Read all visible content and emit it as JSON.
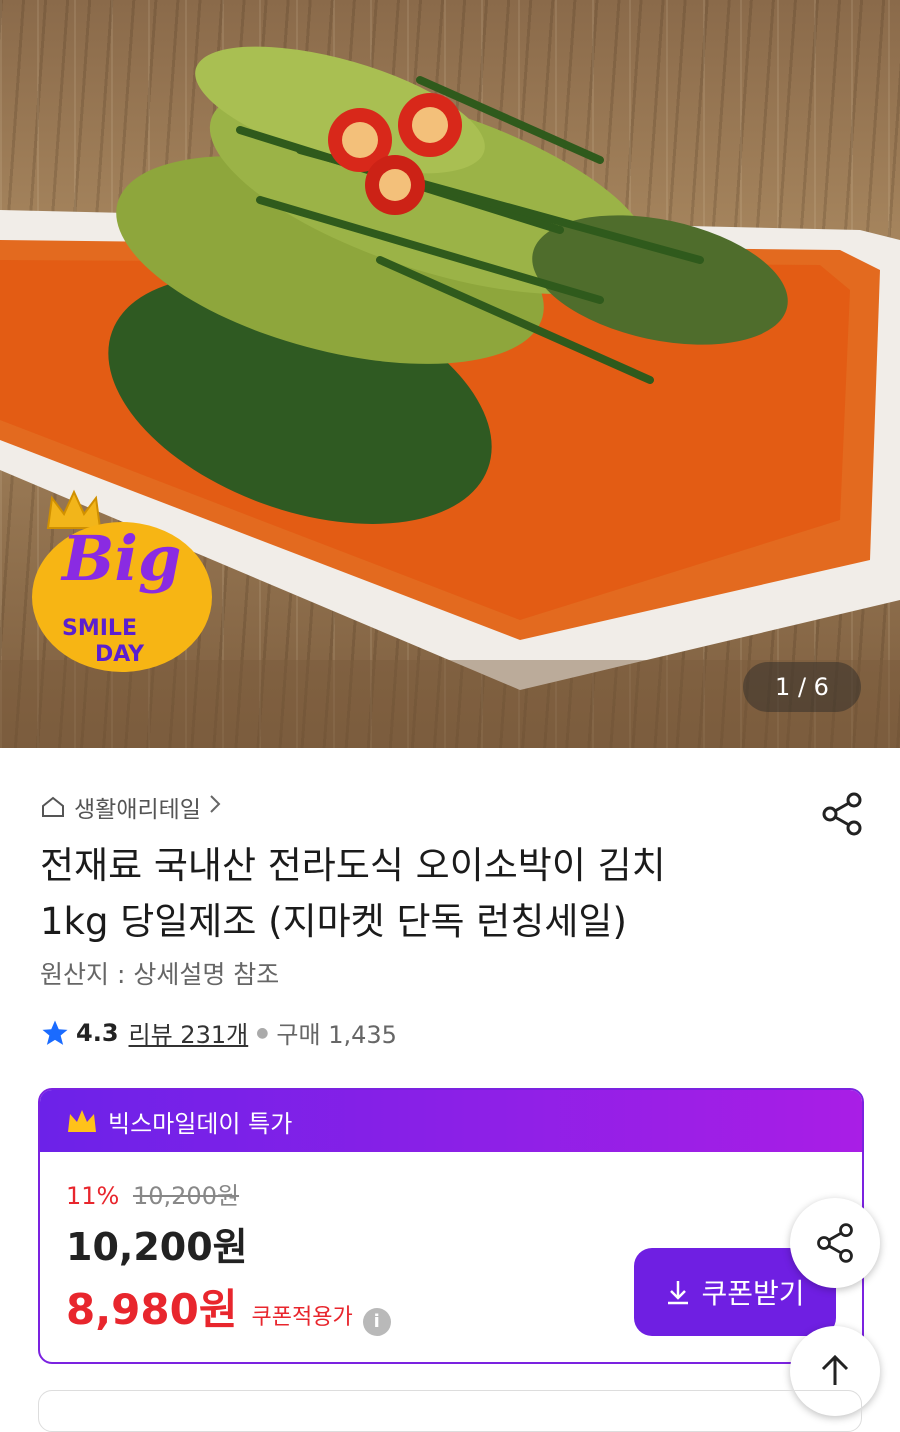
{
  "hero": {
    "pager": "1 / 6",
    "badge": {
      "line1": "Big",
      "line2": "SMILE",
      "line3": "DAY"
    }
  },
  "breadcrumb": {
    "label": "생활애리테일"
  },
  "product": {
    "title_line1": "전재료 국내산 전라도식 오이소박이 김치",
    "title_line2": "1kg 당일제조 (지마켓 단독 런칭세일)",
    "origin": "원산지 : 상세설명 참조",
    "rating": "4.3",
    "review": "리뷰 231개",
    "purchase": "구매 1,435"
  },
  "deal": {
    "header": "빅스마일데이 특가",
    "discount_rate": "11%",
    "original_price": "10,200원",
    "price": "10,200원",
    "coupon_price": "8,980원",
    "coupon_label": "쿠폰적용가",
    "coupon_button": "쿠폰받기"
  },
  "colors": {
    "accent_purple": "#6f1fe2",
    "price_red": "#e8262d",
    "badge_yellow": "#f7b514"
  }
}
